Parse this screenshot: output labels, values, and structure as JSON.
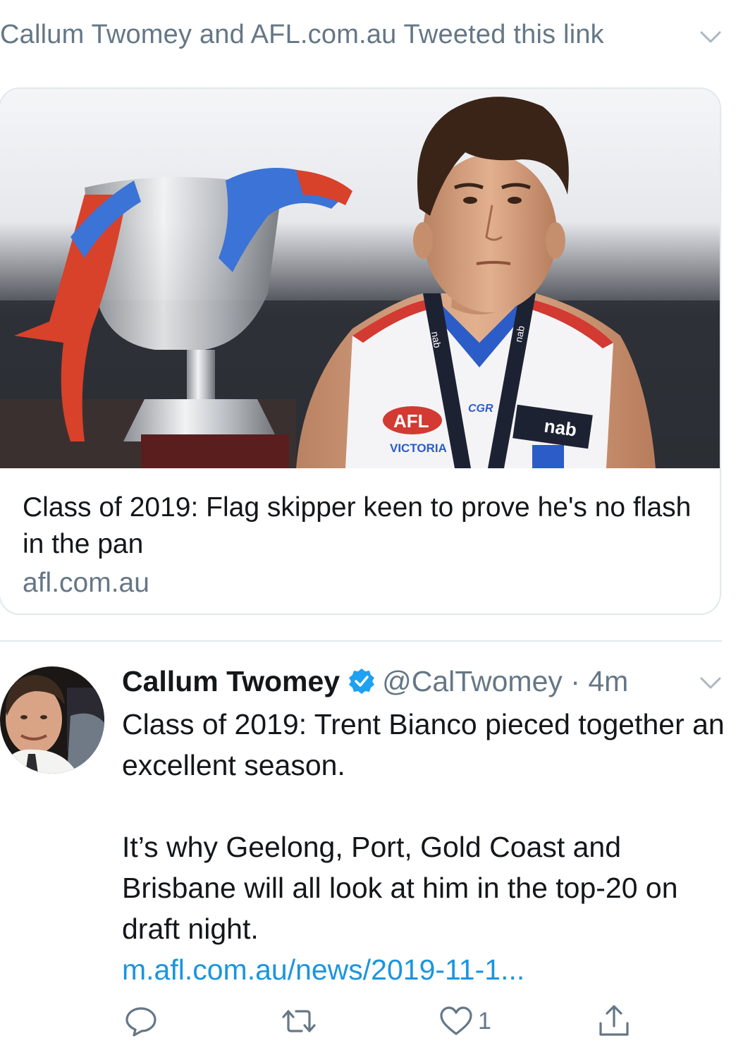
{
  "header": {
    "text": "Callum Twomey and AFL.com.au Tweeted this link"
  },
  "card": {
    "title": "Class of 2019: Flag skipper keen to prove he's no flash in the pan",
    "domain": "afl.com.au",
    "image": {
      "guernsey_texts": {
        "afl": "AFL",
        "victoria": "VICTORIA",
        "sponsor": "nab",
        "brand": "CGR"
      }
    }
  },
  "tweet": {
    "author": "Callum Twomey",
    "handle": "@CalTwomey",
    "separator": "·",
    "time": "4m",
    "line1": "Class of 2019: Trent Bianco pieced together an excellent season.",
    "line2": "It’s why Geelong, Port, Gold Coast and Brisbane will all look at him in the top-20 on draft night.",
    "link": "m.afl.com.au/news/2019-11-1..."
  },
  "actions": {
    "reply_count": "",
    "retweet_count": "",
    "like_count": "1"
  },
  "colors": {
    "text": "#14171a",
    "secondary": "#657786",
    "link": "#1b95e0",
    "border": "#e1e8ed",
    "verified": "#1da1f2"
  },
  "icons": [
    "chevron-down-icon",
    "verified-badge-icon",
    "reply-icon",
    "retweet-icon",
    "like-icon",
    "share-icon"
  ]
}
